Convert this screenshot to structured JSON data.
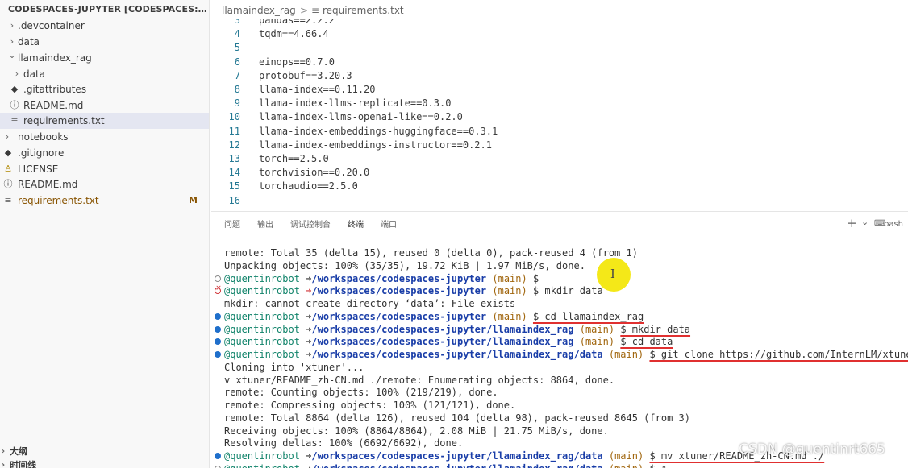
{
  "sidebar": {
    "header": "CODESPACES-JUPYTER [CODESPACES: CONGENIAL ...",
    "items": [
      {
        "label": ".devcontainer",
        "chevron": "›",
        "icon": ""
      },
      {
        "label": "data",
        "chevron": "›",
        "icon": ""
      },
      {
        "label": "llamaindex_rag",
        "chevron": "⌄",
        "icon": ""
      },
      {
        "label": "data",
        "chevron": "›",
        "icon": ""
      },
      {
        "label": ".gitattributes",
        "chevron": "",
        "icon": "◆"
      },
      {
        "label": "README.md",
        "chevron": "",
        "icon": "ⓘ"
      },
      {
        "label": "requirements.txt",
        "chevron": "",
        "icon": "≡"
      },
      {
        "label": "notebooks",
        "chevron": "›",
        "icon": ""
      },
      {
        "label": ".gitignore",
        "chevron": "",
        "icon": "◆"
      },
      {
        "label": "LICENSE",
        "chevron": "",
        "icon": "♙"
      },
      {
        "label": "README.md",
        "chevron": "",
        "icon": "ⓘ"
      },
      {
        "label": "requirements.txt",
        "chevron": "",
        "icon": "≡",
        "badge": "M"
      }
    ],
    "outline_label": "大纲",
    "timeline_label": "时间线"
  },
  "breadcrumb": {
    "folder": "llamaindex_rag",
    "separator": ">",
    "file_icon": "≡",
    "file": "requirements.txt"
  },
  "editor": {
    "lines": [
      {
        "n": "3",
        "text": "pandas==2.2.2"
      },
      {
        "n": "4",
        "text": "tqdm==4.66.4"
      },
      {
        "n": "5",
        "text": ""
      },
      {
        "n": "6",
        "text": "einops==0.7.0"
      },
      {
        "n": "7",
        "text": "protobuf==3.20.3"
      },
      {
        "n": "8",
        "text": "llama-index==0.11.20"
      },
      {
        "n": "9",
        "text": "llama-index-llms-replicate==0.3.0"
      },
      {
        "n": "10",
        "text": "llama-index-llms-openai-like==0.2.0"
      },
      {
        "n": "11",
        "text": "llama-index-embeddings-huggingface==0.3.1"
      },
      {
        "n": "12",
        "text": "llama-index-embeddings-instructor==0.2.1"
      },
      {
        "n": "13",
        "text": "torch==2.5.0"
      },
      {
        "n": "14",
        "text": "torchvision==0.20.0"
      },
      {
        "n": "15",
        "text": "torchaudio==2.5.0"
      },
      {
        "n": "16",
        "text": ""
      }
    ]
  },
  "panel": {
    "tabs": [
      "问题",
      "输出",
      "调试控制台",
      "终端",
      "端口"
    ],
    "active_tab": "终端",
    "actions": {
      "add": "+",
      "dropdown": "⌄",
      "shell": "bash"
    }
  },
  "terminal": {
    "prompt_user": "@quentinrobot",
    "arrow": "➜",
    "branch": "(main)",
    "lines": [
      {
        "type": "out",
        "text": "remote: Total 35 (delta 15), reused 0 (delta 0), pack-reused 4 (from 1)"
      },
      {
        "type": "out",
        "text": "Unpacking objects: 100% (35/35), 19.72 KiB | 1.97 MiB/s, done."
      },
      {
        "type": "prompt",
        "status": "empty",
        "path": "/workspaces/codespaces-jupyter",
        "cmd": "$"
      },
      {
        "type": "prompt",
        "status": "err",
        "path": "/workspaces/codespaces-jupyter",
        "cmd": "$ mkdir data"
      },
      {
        "type": "out",
        "text": "mkdir: cannot create directory ‘data’: File exists"
      },
      {
        "type": "prompt",
        "status": "ok",
        "path": "/workspaces/codespaces-jupyter",
        "cmd": "$ cd llamaindex_rag"
      },
      {
        "type": "prompt",
        "status": "ok",
        "path": "/workspaces/codespaces-jupyter/llamaindex_rag",
        "cmd": "$ mkdir data"
      },
      {
        "type": "prompt",
        "status": "ok",
        "path": "/workspaces/codespaces-jupyter/llamaindex_rag",
        "cmd": "$ cd data"
      },
      {
        "type": "prompt",
        "status": "ok",
        "path": "/workspaces/codespaces-jupyter/llamaindex_rag/data",
        "cmd": "$ git clone https://github.com/InternLM/xtuner.git"
      },
      {
        "type": "out",
        "text": "Cloning into 'xtuner'..."
      },
      {
        "type": "out",
        "text": "v xtuner/README_zh-CN.md ./remote: Enumerating objects: 8864, done."
      },
      {
        "type": "out",
        "text": "remote: Counting objects: 100% (219/219), done."
      },
      {
        "type": "out",
        "text": "remote: Compressing objects: 100% (121/121), done."
      },
      {
        "type": "out",
        "text": "remote: Total 8864 (delta 126), reused 104 (delta 98), pack-reused 8645 (from 3)"
      },
      {
        "type": "out",
        "text": "Receiving objects: 100% (8864/8864), 2.08 MiB | 21.75 MiB/s, done."
      },
      {
        "type": "out",
        "text": "Resolving deltas: 100% (6692/6692), done."
      },
      {
        "type": "prompt",
        "status": "ok",
        "path": "/workspaces/codespaces-jupyter/llamaindex_rag/data",
        "cmd": "$ mv xtuner/README_zh-CN.md ./"
      },
      {
        "type": "prompt",
        "status": "empty",
        "path": "/workspaces/codespaces-jupyter/llamaindex_rag/data",
        "cmd": "$ ▯"
      }
    ]
  },
  "watermark": "CSDN @quentinrt665",
  "colors": {
    "selection": "#e4e6f1",
    "accent": "#005fb8",
    "path": "#1a3ea8",
    "user": "#10836a",
    "annotation": "#e03030",
    "pointer_highlight": "#f3e600"
  }
}
